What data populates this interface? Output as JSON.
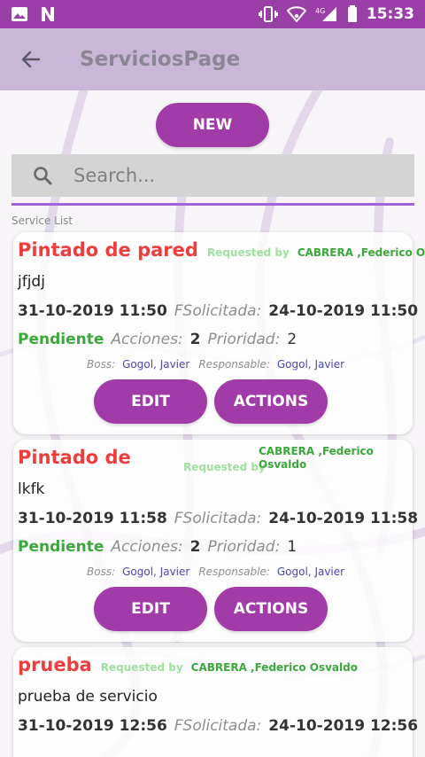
{
  "statusbar": {
    "time": "15:33",
    "icons": [
      "image-icon",
      "n-icon",
      "vibrate-icon",
      "wifi-icon",
      "signal-4g-icon",
      "battery-icon"
    ],
    "network_label": "4G"
  },
  "appbar": {
    "title": "ServiciosPage",
    "back_icon": "back-arrow-icon"
  },
  "new_button": "NEW",
  "search": {
    "placeholder": "Search..."
  },
  "list_label": "Service List",
  "labels": {
    "requested_by": "Requested by",
    "fsolicitada": "FSolicitada:",
    "acciones": "Acciones:",
    "prioridad": "Prioridad:",
    "boss": "Boss:",
    "responsable": "Responsable:",
    "edit": "EDIT",
    "actions": "ACTIONS"
  },
  "services": [
    {
      "title": "Pintado de pared",
      "client": "CABRERA ,Federico Osvaldo",
      "description": "jfjdj",
      "date": "31-10-2019 11:50",
      "requested_date": "24-10-2019 11:50",
      "status": "Pendiente",
      "acciones": "2",
      "prioridad": "2",
      "boss": "Gogol, Javier",
      "responsable": "Gogol, Javier"
    },
    {
      "title": "Pintado de",
      "client_line1": "CABRERA ,Federico",
      "client_line2": "Osvaldo",
      "description": "lkfk",
      "date": "31-10-2019 11:58",
      "requested_date": "24-10-2019 11:58",
      "status": "Pendiente",
      "acciones": "2",
      "prioridad": "1",
      "boss": "Gogol, Javier",
      "responsable": "Gogol, Javier"
    },
    {
      "title": "prueba",
      "client": "CABRERA ,Federico Osvaldo",
      "description": "prueba de servicio",
      "date": "31-10-2019 12:56",
      "requested_date": "24-10-2019 12:56"
    }
  ],
  "colors": {
    "statusbar": "#9b3fa8",
    "appbar": "#c8b7d6",
    "accent": "#a03ba8",
    "title_red": "#ee3d3d",
    "status_green": "#3aa83a",
    "search_underline": "#a064d6"
  }
}
